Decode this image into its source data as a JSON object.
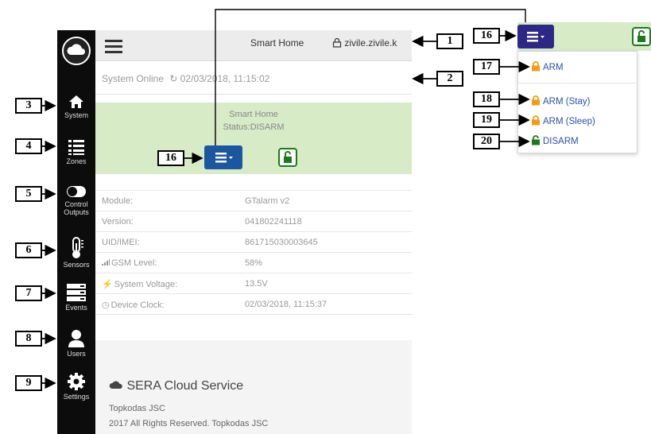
{
  "header": {
    "title": "Smart Home",
    "user": "zivile.zivile.k"
  },
  "status": {
    "text": "System Online",
    "time": "02/03/2018, 11:15:02"
  },
  "panel": {
    "title": "Smart Home",
    "status": "Status:DISARM"
  },
  "sidebar": {
    "items": [
      {
        "label": "System",
        "icon": "home-icon"
      },
      {
        "label": "Zones",
        "icon": "list-icon"
      },
      {
        "label": "Control Outputs",
        "icon": "toggle-icon"
      },
      {
        "label": "Sensors",
        "icon": "thermometer-icon"
      },
      {
        "label": "Events",
        "icon": "server-icon"
      },
      {
        "label": "Users",
        "icon": "user-icon"
      },
      {
        "label": "Settings",
        "icon": "gear-icon"
      }
    ]
  },
  "info": {
    "rows": [
      {
        "label": "Module:",
        "value": "GTalarm v2"
      },
      {
        "label": "Version:",
        "value": "041802241118"
      },
      {
        "label": "UID/IMEI:",
        "value": "861715030003645"
      },
      {
        "label": "GSM Level:",
        "value": "58%"
      },
      {
        "label": "System Voltage:",
        "value": "13.5V"
      },
      {
        "label": "Device Clock:",
        "value": "02/03/2018, 11:15:37"
      }
    ]
  },
  "footer": {
    "title": "SERA Cloud Service",
    "company": "Topkodas JSC",
    "rights": "2017 All Rights Reserved. Topkodas JSC"
  },
  "dropdown": {
    "items": [
      {
        "label": "ARM",
        "icon": "lock-closed-icon",
        "color": "#f39c12"
      },
      {
        "label": "ARM (Stay)",
        "icon": "lock-closed-icon",
        "color": "#f39c12"
      },
      {
        "label": "ARM (Sleep)",
        "icon": "lock-closed-icon",
        "color": "#f39c12"
      },
      {
        "label": "DISARM",
        "icon": "lock-open-icon",
        "color": "#1c7a1c"
      }
    ]
  },
  "callouts": {
    "c1": "1",
    "c2": "2",
    "c3": "3",
    "c4": "4",
    "c5": "5",
    "c6": "6",
    "c7": "7",
    "c8": "8",
    "c9": "9",
    "c16a": "16",
    "c16b": "16",
    "c17": "17",
    "c18": "18",
    "c19": "19",
    "c20": "20"
  },
  "colors": {
    "sidebar": "#0c0c0c",
    "panel_green": "#d7ebc6",
    "menu_blue": "#1d56a0",
    "menu_dark": "#2d2787",
    "lock_orange": "#f39c12",
    "lock_green": "#1c7a1c"
  }
}
